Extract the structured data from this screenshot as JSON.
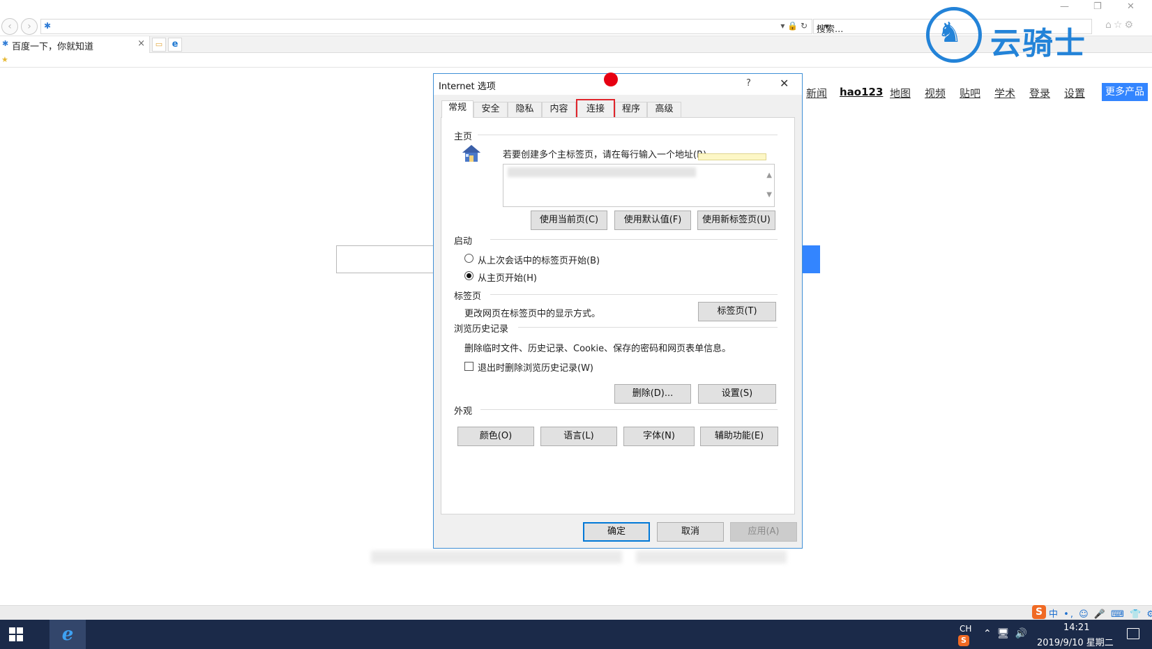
{
  "browser": {
    "search_placeholder": "搜索...",
    "tab_title": "百度一下，你就知道",
    "tab_close": "×"
  },
  "logo": {
    "text": "云骑士"
  },
  "baidu": {
    "nav": [
      "新闻",
      "hao123",
      "地图",
      "视频",
      "贴吧",
      "学术",
      "登录",
      "设置"
    ],
    "more_products": "更多产品"
  },
  "dialog": {
    "title": "Internet 选项",
    "help": "?",
    "close": "✕",
    "tabs": [
      "常规",
      "安全",
      "隐私",
      "内容",
      "连接",
      "程序",
      "高级"
    ],
    "active_tab": "常规",
    "highlighted_tab": "连接",
    "home": {
      "title": "主页",
      "desc": "若要创建多个主标签页，请在每行输入一个地址(R)",
      "buttons": [
        "使用当前页(C)",
        "使用默认值(F)",
        "使用新标签页(U)"
      ]
    },
    "startup": {
      "title": "启动",
      "options": [
        "从上次会话中的标签页开始(B)",
        "从主页开始(H)"
      ],
      "selected_index": 1
    },
    "tabs_section": {
      "title": "标签页",
      "desc": "更改网页在标签页中的显示方式。",
      "button": "标签页(T)"
    },
    "history": {
      "title": "浏览历史记录",
      "desc": "删除临时文件、历史记录、Cookie、保存的密码和网页表单信息。",
      "checkbox": "退出时删除浏览历史记录(W)",
      "checked": false,
      "buttons": [
        "删除(D)...",
        "设置(S)"
      ]
    },
    "appearance": {
      "title": "外观",
      "buttons": [
        "颜色(O)",
        "语言(L)",
        "字体(N)",
        "辅助功能(E)"
      ]
    },
    "footer": {
      "ok": "确定",
      "cancel": "取消",
      "apply": "应用(A)"
    }
  },
  "taskbar": {
    "lang": "CH",
    "ime": "中",
    "time": "14:21",
    "date": "2019/9/10 星期二"
  },
  "colors": {
    "dialog_border": "#3f8fd6",
    "highlight": "#e0242b",
    "baidu_blue": "#3385ff",
    "taskbar": "#1b2a49",
    "logo_blue": "#2383d8"
  }
}
